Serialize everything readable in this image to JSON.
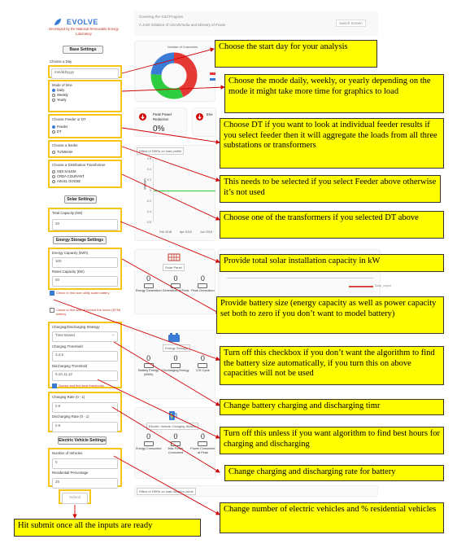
{
  "app": {
    "name": "EVOLVE",
    "developer": "Developed by the National Renewable Energy Laboratory",
    "header_title": "Greening the Grid Program",
    "header_subtitle": "A Joint Initiative of USAID/India and Ministry of Power",
    "switch_screen": "Switch Screen"
  },
  "sidebar": {
    "base_settings": "Base Settings",
    "choose_day_label": "Choose a Day",
    "choose_day_placeholder": "mm/dd/yyyy",
    "mode_label": "Mode of time",
    "mode_options": [
      "Daily",
      "Weekly",
      "Yearly"
    ],
    "mode_selected": "Daily",
    "feeder_dt_label": "Choose Feeder or DT",
    "feeder_dt_options": [
      "Feeder",
      "DT"
    ],
    "feeder_label": "Choose a feeder",
    "feeder_option": "TUNISHIA",
    "transformer_label": "Choose a Distribution Transformer",
    "transformer_options": [
      "SIDI SALEM",
      "CRDA COURANT",
      "AIN EL GOSSE"
    ],
    "solar_settings": "Solar Settings",
    "total_capacity_label": "Total Capacity (kW)",
    "total_capacity_value": "20",
    "storage_settings": "Energy Storage Settings",
    "energy_capacity_label": "Energy Capacity (kWh)",
    "energy_capacity_value": "100",
    "rated_capacity_label": "Rated Capacity (kW)",
    "rated_capacity_value": "50",
    "check_utility": "Check to find size utility scale battery",
    "check_btm": "Check to find size of behind the meter (BTM) battery",
    "strategy_label": "Charging/Discharging Strategy",
    "strategy_value": "Time Based",
    "charging_threshold_label": "Charging Threshold",
    "charging_threshold_value": "3,4,5",
    "discharging_threshold_label": "Discharging Threshold",
    "discharging_threshold_value": "9,10,11,12",
    "sweep_label": "Sweep and find best thresholds",
    "charging_rate_label": "Charging Rate (0 - 1)",
    "charging_rate_value": "0.8",
    "discharging_rate_label": "Discharging Rate (0 - 1)",
    "discharging_rate_value": "0.6",
    "ev_settings": "Electric Vehicle Settings",
    "num_vehicles_label": "Number of Vehicles",
    "num_vehicles_value": "0",
    "residential_label": "Residential Percentage",
    "residential_value": "25",
    "submit": "Submit"
  },
  "main": {
    "donut_title": "Number of Customers",
    "peak_reduction_label": "Peak Power Reduction",
    "peak_reduction_value": "0%",
    "energy_cut": "Ene",
    "profile_title": "Effect of DERs on load profile",
    "axis_ticks": [
      "0.6",
      "0.4",
      "0.2",
      "0",
      "-0.2",
      "-0.4",
      "-0.6"
    ],
    "axis_label": "kW/kWh",
    "x_ticks": [
      "Feb 2018",
      "Apr 2018",
      "Jun 2018"
    ],
    "solar_card_title": "Solar Panel",
    "solar_stats": [
      {
        "value": "0",
        "label": "Energy Generation"
      },
      {
        "value": "0",
        "label": "Generation at Peak"
      },
      {
        "value": "0",
        "label": "Peak Generation"
      }
    ],
    "legend_solar": "Solar_output",
    "storage_card_title": "Energy Storage",
    "storage_stats": [
      {
        "value": "0",
        "label": "Battery Energy (MWh)"
      },
      {
        "value": "0",
        "label": "Discharging Energy"
      },
      {
        "value": "0",
        "label": "C/D Cycle"
      }
    ],
    "ev_card_title": "Electric Vehicle Charging Station",
    "ev_stats": [
      {
        "value": "0",
        "label": "Energy Consumed"
      },
      {
        "value": "0",
        "label": "Max Power Consumed"
      },
      {
        "value": "0",
        "label": "Power Consumed at Peak"
      }
    ],
    "duration_title": "Effect of DERs on load duration curve"
  },
  "callouts": {
    "start_day": "Choose the start day for your analysis",
    "mode": "Choose the mode daily, weekly, or yearly depending on the mode it might take more time for graphics to load",
    "dt": "Choose DT if you want to look at individual feeder results if you select feeder then it will aggregate the loads from all three substations or transformers",
    "feeder": "This needs to be selected if you select Feeder above otherwise it’s not used",
    "transformer": "Choose one of the transformers if you selected DT above",
    "solar": "Provide total solar installation capacity in kW",
    "battery": "Provide battery size (energy capacity as well as power capacity set both to zero if you don’t want to model battery)",
    "checkbox": "Turn off this checkbox if you don’t want the algorithm to find the battery size automatically, if you turn this on above capacities will not be used",
    "charging_time": "Change battery charging and discharging timr",
    "best_hours": "Turn off this unless if you want algorithm to find best hours for charging and discharging",
    "rate": "Change charging and discharging rate for battery",
    "ev": "Change number of electric vehicles and % residential vehicles",
    "submit": "Hit submit once all the inputs are ready"
  },
  "colors": {
    "highlight": "#f5c518",
    "callout_bg": "#ffff00",
    "arrow": "#d00000",
    "donut": [
      "#e53935",
      "#3a7bd5",
      "#2ecc40"
    ]
  }
}
